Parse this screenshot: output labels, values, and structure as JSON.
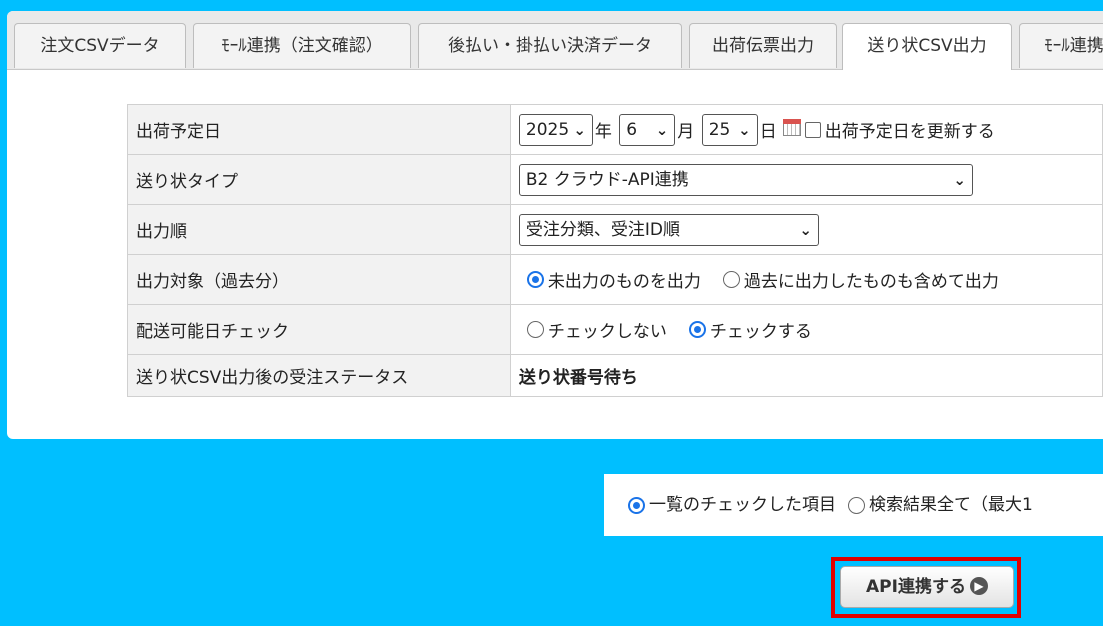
{
  "tabs": [
    {
      "label": "注文CSVデータ"
    },
    {
      "label": "ﾓｰﾙ連携（注文確認）"
    },
    {
      "label": "後払い・掛払い決済データ"
    },
    {
      "label": "出荷伝票出力"
    },
    {
      "label": "送り状CSV出力"
    },
    {
      "label": "ﾓｰﾙ連携"
    }
  ],
  "active_tab": "送り状CSV出力",
  "form": {
    "ship_date": {
      "label": "出荷予定日",
      "year": "2025",
      "year_unit": "年",
      "month": "6",
      "month_unit": "月",
      "day": "25",
      "day_unit": "日",
      "update_checkbox_label": "出荷予定日を更新する",
      "update_checked": false
    },
    "invoice_type": {
      "label": "送り状タイプ",
      "value": "B2 クラウド-API連携"
    },
    "output_order": {
      "label": "出力順",
      "value": "受注分類、受注ID順"
    },
    "output_target": {
      "label": "出力対象（過去分）",
      "options": [
        "未出力のものを出力",
        "過去に出力したものも含めて出力"
      ],
      "selected": 0
    },
    "delivery_check": {
      "label": "配送可能日チェック",
      "options": [
        "チェックしない",
        "チェックする"
      ],
      "selected": 1
    },
    "status_after": {
      "label": "送り状CSV出力後の受注ステータス",
      "value": "送り状番号待ち"
    }
  },
  "scope": {
    "options": [
      "一覧のチェックした項目",
      "検索結果全て（最大1"
    ],
    "selected": 0
  },
  "api_button": {
    "label": "API連携する",
    "icon": "arrow-right-circle-icon"
  },
  "colors": {
    "background": "#00bfff",
    "highlight_frame": "#e00000",
    "radio_accent": "#1a73e8"
  }
}
